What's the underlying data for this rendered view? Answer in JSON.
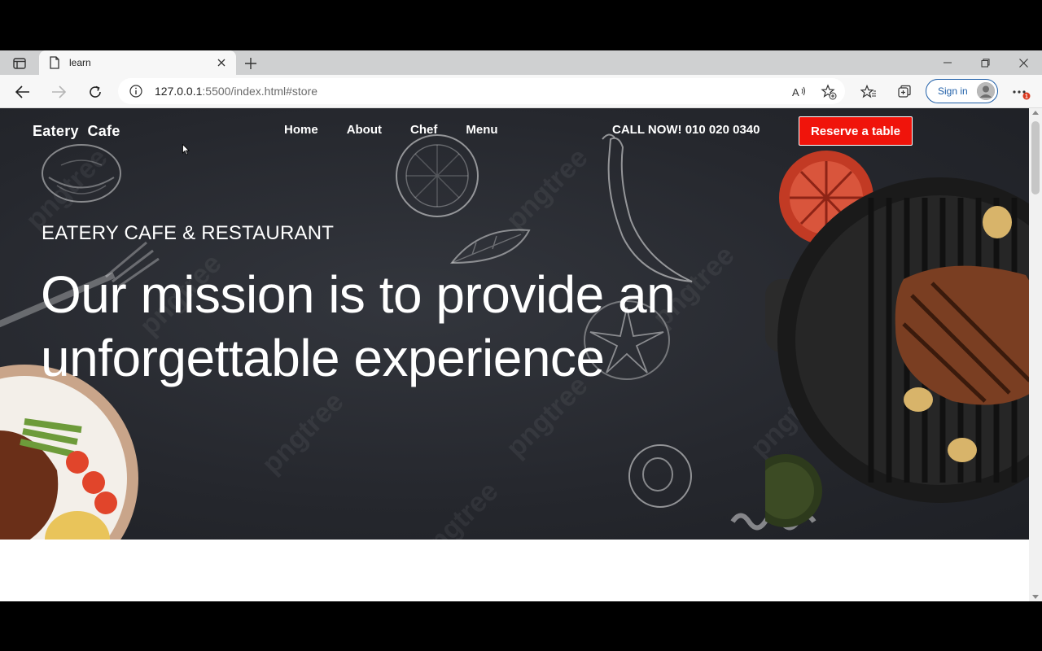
{
  "browser": {
    "tab_title": "learn",
    "url_host": "127.0.0.1",
    "url_rest": ":5500/index.html#store",
    "signin_label": "Sign in",
    "notification_badge": "1"
  },
  "site": {
    "brand": "Eatery  Cafe",
    "nav": [
      "Home",
      "About",
      "Chef",
      "Menu"
    ],
    "call": "CALL NOW! 010 020 0340",
    "reserve_label": "Reserve a table",
    "subtitle": "EATERY CAFE & RESTAURANT",
    "headline": "Our mission is to provide an unforgettable experience",
    "watermark_text": "pngtree"
  },
  "colors": {
    "reserve_button": "#f0140b",
    "hero_background": "#25272d",
    "signin_accent": "#1f5fa8"
  }
}
